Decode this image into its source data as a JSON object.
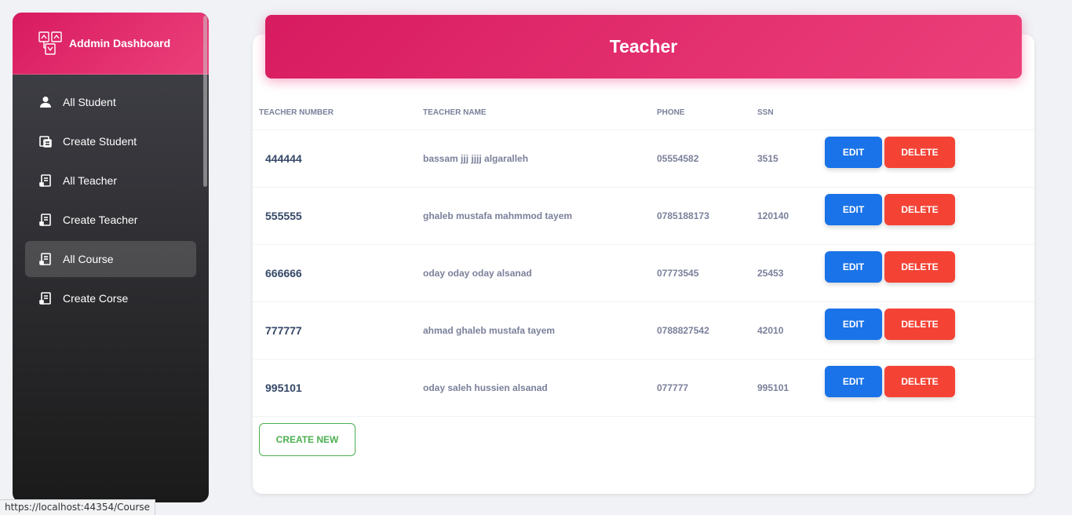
{
  "sidebar": {
    "brand_title": "Addmin Dashboard",
    "items": [
      {
        "label": "All Student",
        "icon": "person-icon"
      },
      {
        "label": "Create Student",
        "icon": "form-icon"
      },
      {
        "label": "All Teacher",
        "icon": "receipt-icon"
      },
      {
        "label": "Create Teacher",
        "icon": "receipt-icon"
      },
      {
        "label": "All Course",
        "icon": "receipt-icon",
        "active": true
      },
      {
        "label": "Create Corse",
        "icon": "receipt-icon"
      }
    ]
  },
  "page": {
    "title": "Teacher"
  },
  "table": {
    "headers": [
      "TEACHER NUMBER",
      "TEACHER NAME",
      "PHONE",
      "SSN"
    ],
    "rows": [
      {
        "number": "444444",
        "name": "bassam jjj jjjj algaralleh",
        "phone": "05554582",
        "ssn": "3515"
      },
      {
        "number": "555555",
        "name": "ghaleb mustafa mahmmod tayem",
        "phone": "0785188173",
        "ssn": "120140"
      },
      {
        "number": "666666",
        "name": "oday oday oday alsanad",
        "phone": "07773545",
        "ssn": "25453"
      },
      {
        "number": "777777",
        "name": "ahmad ghaleb mustafa tayem",
        "phone": "0788827542",
        "ssn": "42010"
      },
      {
        "number": "995101",
        "name": "oday saleh hussien alsanad",
        "phone": "077777",
        "ssn": "995101"
      }
    ],
    "edit_label": "EDIT",
    "delete_label": "DELETE"
  },
  "actions": {
    "create_new_label": "CREATE NEW"
  },
  "statusbar": {
    "url": "https://localhost:44354/Course"
  },
  "colors": {
    "brand": "#e91e63",
    "edit": "#1a73e8",
    "delete": "#f44335",
    "create": "#4caf50"
  }
}
